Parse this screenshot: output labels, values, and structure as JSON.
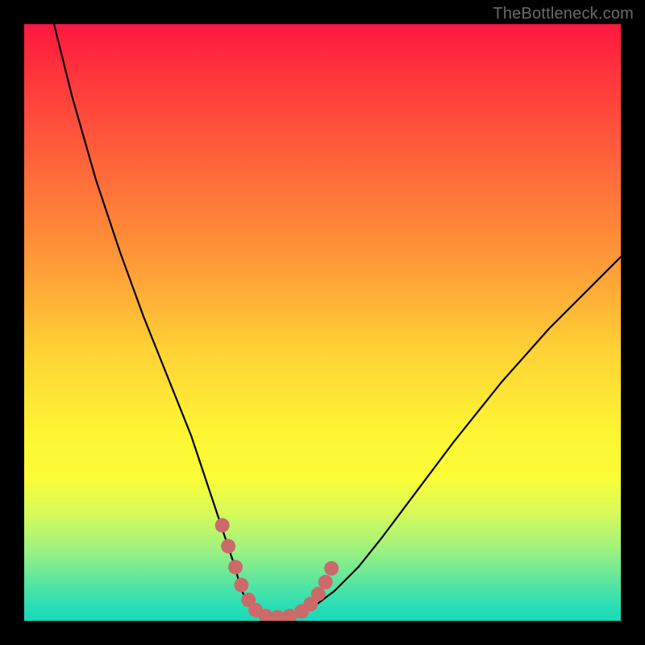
{
  "watermark": "TheBottleneck.com",
  "chart_data": {
    "type": "line",
    "title": "",
    "xlabel": "",
    "ylabel": "",
    "xlim": [
      0,
      100
    ],
    "ylim": [
      0,
      100
    ],
    "series": [
      {
        "name": "curve",
        "color": "#000000",
        "x": [
          5,
          8,
          12,
          16,
          20,
          24,
          28,
          31,
          33,
          35,
          36.5,
          38,
          40,
          44,
          48,
          52,
          56,
          60,
          66,
          72,
          80,
          88,
          96,
          100
        ],
        "y": [
          100,
          88,
          74,
          62,
          51,
          41,
          31,
          22,
          16,
          10,
          5,
          2,
          0.5,
          0.5,
          2,
          5,
          9,
          14,
          22,
          30,
          40,
          49,
          57,
          61
        ]
      },
      {
        "name": "highlight-dots",
        "color": "#cc6a6a",
        "x": [
          33.2,
          34.2,
          35.4,
          36.4,
          37.6,
          38.8,
          40.5,
          42.5,
          44.5,
          46.5,
          48.0,
          49.3,
          50.5,
          51.5
        ],
        "y": [
          16.0,
          12.5,
          9.0,
          6.0,
          3.5,
          1.8,
          0.8,
          0.6,
          0.8,
          1.6,
          2.8,
          4.5,
          6.5,
          8.8
        ]
      }
    ]
  }
}
